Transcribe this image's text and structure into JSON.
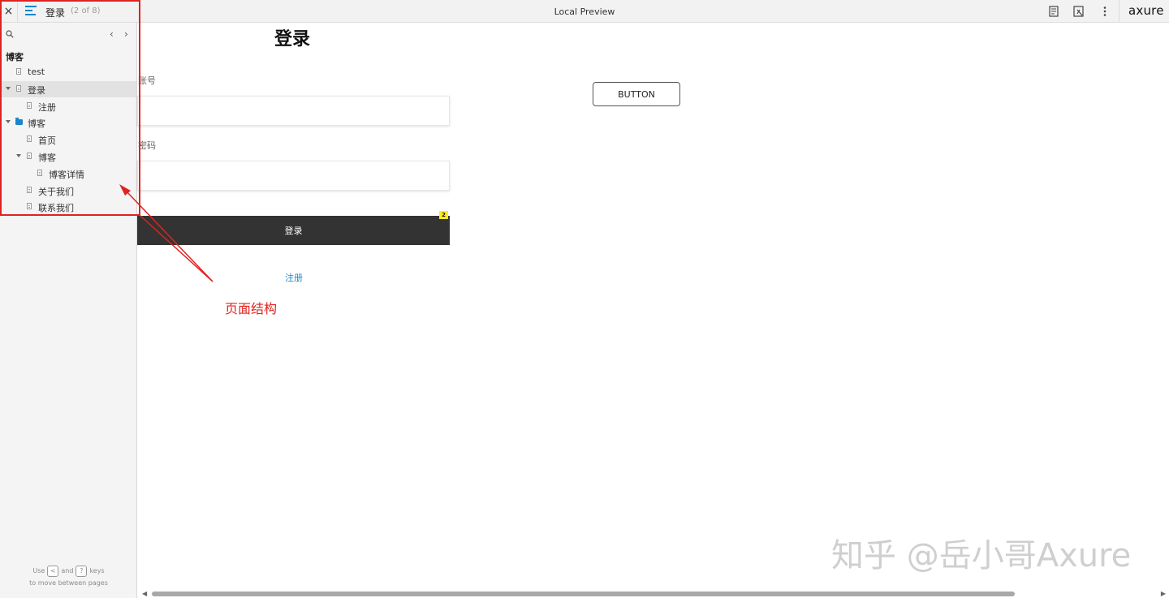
{
  "topbar": {
    "close": "×",
    "page_title": "登录",
    "page_count": "(2 of 8)",
    "center_title": "Local Preview",
    "brand": "axure"
  },
  "sidebar": {
    "project": "博客",
    "prev": "‹",
    "next": "›",
    "items": [
      {
        "label": "test"
      },
      {
        "label": "登录"
      },
      {
        "label": "注册"
      },
      {
        "label": "博客"
      },
      {
        "label": "首页"
      },
      {
        "label": "博客"
      },
      {
        "label": "博客详情"
      },
      {
        "label": "关于我们"
      },
      {
        "label": "联系我们"
      }
    ],
    "hint_use": "Use",
    "hint_key_left": "<",
    "hint_and": "and",
    "hint_key_right": "?",
    "hint_keys": "keys",
    "hint_line2": "to move between pages"
  },
  "canvas": {
    "title": "登录",
    "account_label": "账号",
    "password_label": "密码",
    "login_button": "登录",
    "badge": "2",
    "register_link": "注册",
    "outline_button": "BUTTON"
  },
  "annotation": {
    "text": "页面结构",
    "color": "#e0231f"
  },
  "watermark": "知乎 @岳小哥Axure",
  "colors": {
    "accent": "#1a86c9",
    "login_button_bg": "#333333",
    "badge_bg": "#ffec1f"
  }
}
